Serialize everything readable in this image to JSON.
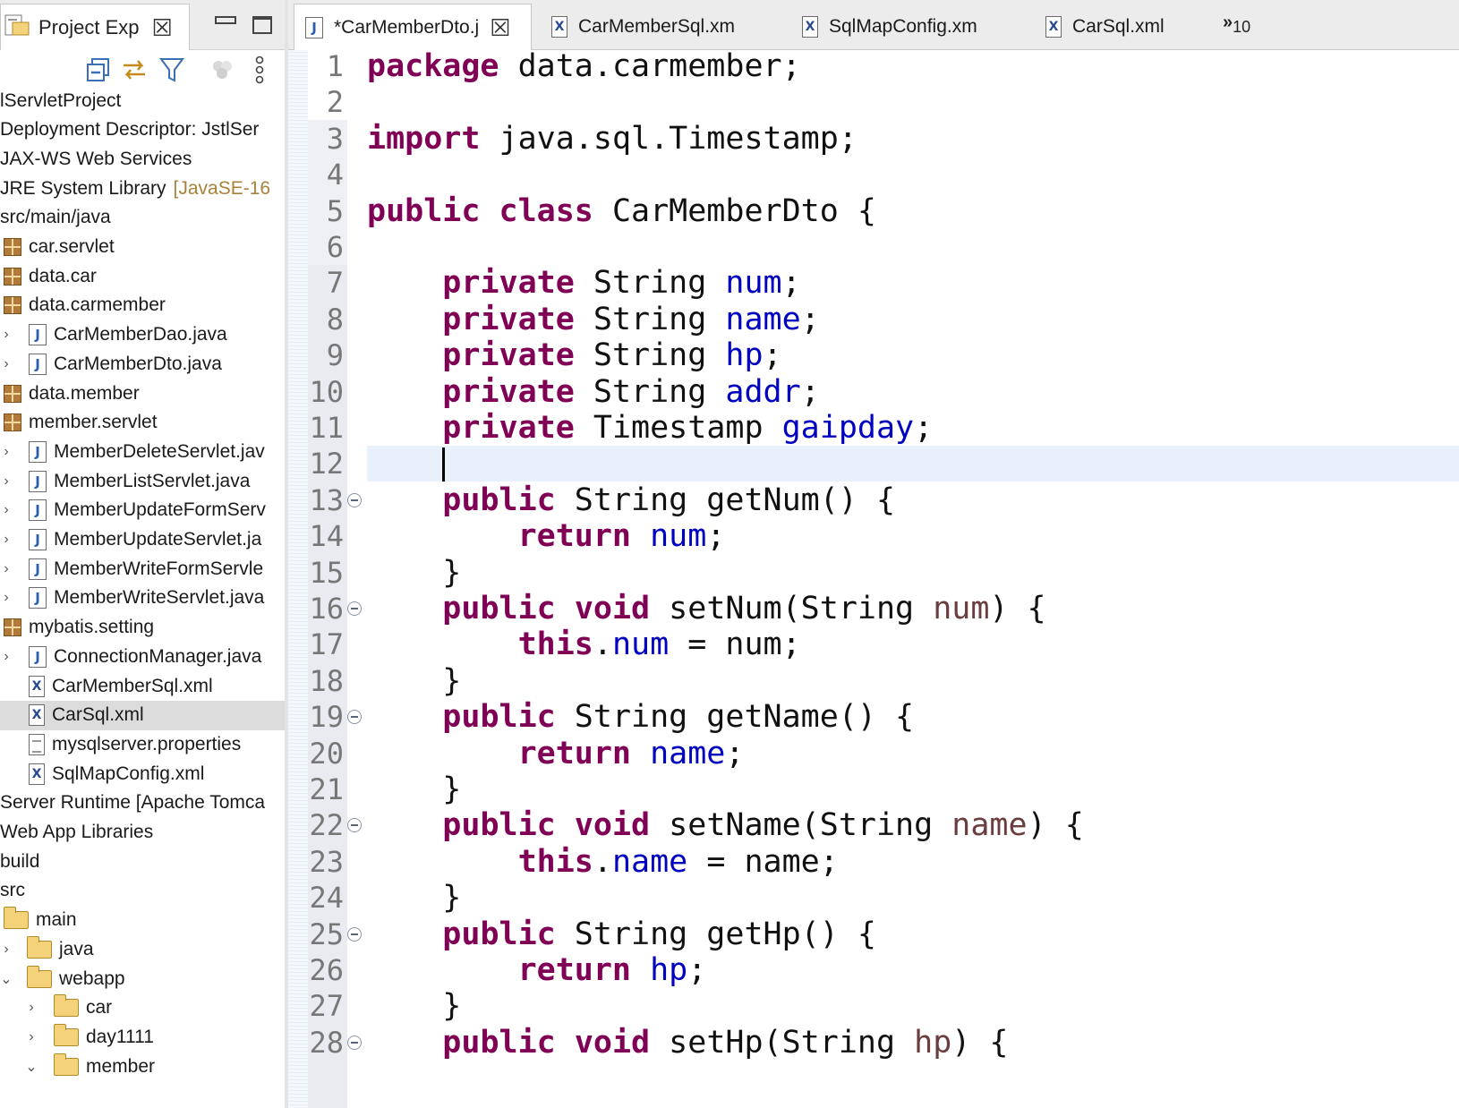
{
  "explorer": {
    "tab_label": "Project Exp",
    "close_symbol": "☒",
    "toolbar_icons": [
      "collapse-all-icon",
      "link-with-editor-icon",
      "filter-icon",
      "focus-icon",
      "view-menu-icon"
    ],
    "items": [
      {
        "label": "lServletProject",
        "icon": "none"
      },
      {
        "label": "Deployment Descriptor: JstlSer",
        "icon": "none"
      },
      {
        "label": "JAX-WS Web Services",
        "icon": "none"
      },
      {
        "label": "JRE System Library",
        "suffix": "[JavaSE-16",
        "icon": "none"
      },
      {
        "label": "src/main/java",
        "icon": "none"
      },
      {
        "label": "car.servlet",
        "icon": "package"
      },
      {
        "label": "data.car",
        "icon": "package"
      },
      {
        "label": "data.carmember",
        "icon": "package"
      },
      {
        "label": "CarMemberDao.java",
        "icon": "java"
      },
      {
        "label": "CarMemberDto.java",
        "icon": "java"
      },
      {
        "label": "data.member",
        "icon": "package"
      },
      {
        "label": "member.servlet",
        "icon": "package"
      },
      {
        "label": "MemberDeleteServlet.jav",
        "icon": "java"
      },
      {
        "label": "MemberListServlet.java",
        "icon": "java"
      },
      {
        "label": "MemberUpdateFormServ",
        "icon": "java"
      },
      {
        "label": "MemberUpdateServlet.ja",
        "icon": "java"
      },
      {
        "label": "MemberWriteFormServle",
        "icon": "java"
      },
      {
        "label": "MemberWriteServlet.java",
        "icon": "java"
      },
      {
        "label": "mybatis.setting",
        "icon": "package"
      },
      {
        "label": "ConnectionManager.java",
        "icon": "java"
      },
      {
        "label": "CarMemberSql.xml",
        "icon": "xml"
      },
      {
        "label": "CarSql.xml",
        "icon": "xml",
        "selected": true
      },
      {
        "label": "mysqlserver.properties",
        "icon": "text"
      },
      {
        "label": "SqlMapConfig.xml",
        "icon": "xml"
      },
      {
        "label": "Server Runtime [Apache Tomca",
        "icon": "none"
      },
      {
        "label": "Web App Libraries",
        "icon": "none"
      },
      {
        "label": "build",
        "icon": "none"
      },
      {
        "label": "src",
        "icon": "none"
      },
      {
        "label": "main",
        "icon": "folder"
      },
      {
        "label": "java",
        "icon": "folder"
      },
      {
        "label": "webapp",
        "icon": "folder"
      },
      {
        "label": "car",
        "icon": "folder"
      },
      {
        "label": "day1111",
        "icon": "folder"
      },
      {
        "label": "member",
        "icon": "folder"
      }
    ]
  },
  "editor": {
    "tabs": [
      {
        "label": "*CarMemberDto.j",
        "icon": "java",
        "active": true
      },
      {
        "label": "CarMemberSql.xm",
        "icon": "xml"
      },
      {
        "label": "SqlMapConfig.xm",
        "icon": "xml"
      },
      {
        "label": "CarSql.xml",
        "icon": "xml"
      }
    ],
    "overflow_symbol": "»",
    "overflow_count": "10",
    "current_line": 12,
    "lines": [
      {
        "n": "1",
        "code": "package data.carmember;"
      },
      {
        "n": "2",
        "code": ""
      },
      {
        "n": "3",
        "code": "import java.sql.Timestamp;"
      },
      {
        "n": "4",
        "code": ""
      },
      {
        "n": "5",
        "code": "public class CarMemberDto {"
      },
      {
        "n": "6",
        "code": ""
      },
      {
        "n": "7",
        "code": "    private String num;"
      },
      {
        "n": "8",
        "code": "    private String name;"
      },
      {
        "n": "9",
        "code": "    private String hp;"
      },
      {
        "n": "10",
        "code": "    private String addr;"
      },
      {
        "n": "11",
        "code": "    private Timestamp gaipday;"
      },
      {
        "n": "12",
        "code": "    "
      },
      {
        "n": "13",
        "code": "    public String getNum() {",
        "fold": true
      },
      {
        "n": "14",
        "code": "        return num;"
      },
      {
        "n": "15",
        "code": "    }"
      },
      {
        "n": "16",
        "code": "    public void setNum(String num) {",
        "fold": true
      },
      {
        "n": "17",
        "code": "        this.num = num;"
      },
      {
        "n": "18",
        "code": "    }"
      },
      {
        "n": "19",
        "code": "    public String getName() {",
        "fold": true
      },
      {
        "n": "20",
        "code": "        return name;"
      },
      {
        "n": "21",
        "code": "    }"
      },
      {
        "n": "22",
        "code": "    public void setName(String name) {",
        "fold": true
      },
      {
        "n": "23",
        "code": "        this.name = name;"
      },
      {
        "n": "24",
        "code": "    }"
      },
      {
        "n": "25",
        "code": "    public String getHp() {",
        "fold": true
      },
      {
        "n": "26",
        "code": "        return hp;"
      },
      {
        "n": "27",
        "code": "    }"
      },
      {
        "n": "28",
        "code": "    public void setHp(String hp) {",
        "fold": true
      }
    ]
  },
  "colors": {
    "keyword": "#7f0055",
    "field": "#0000c0",
    "parameter": "#6a3e3e",
    "current_line_bg": "#e8f0fb",
    "selection_bg": "#dcdcdc"
  }
}
